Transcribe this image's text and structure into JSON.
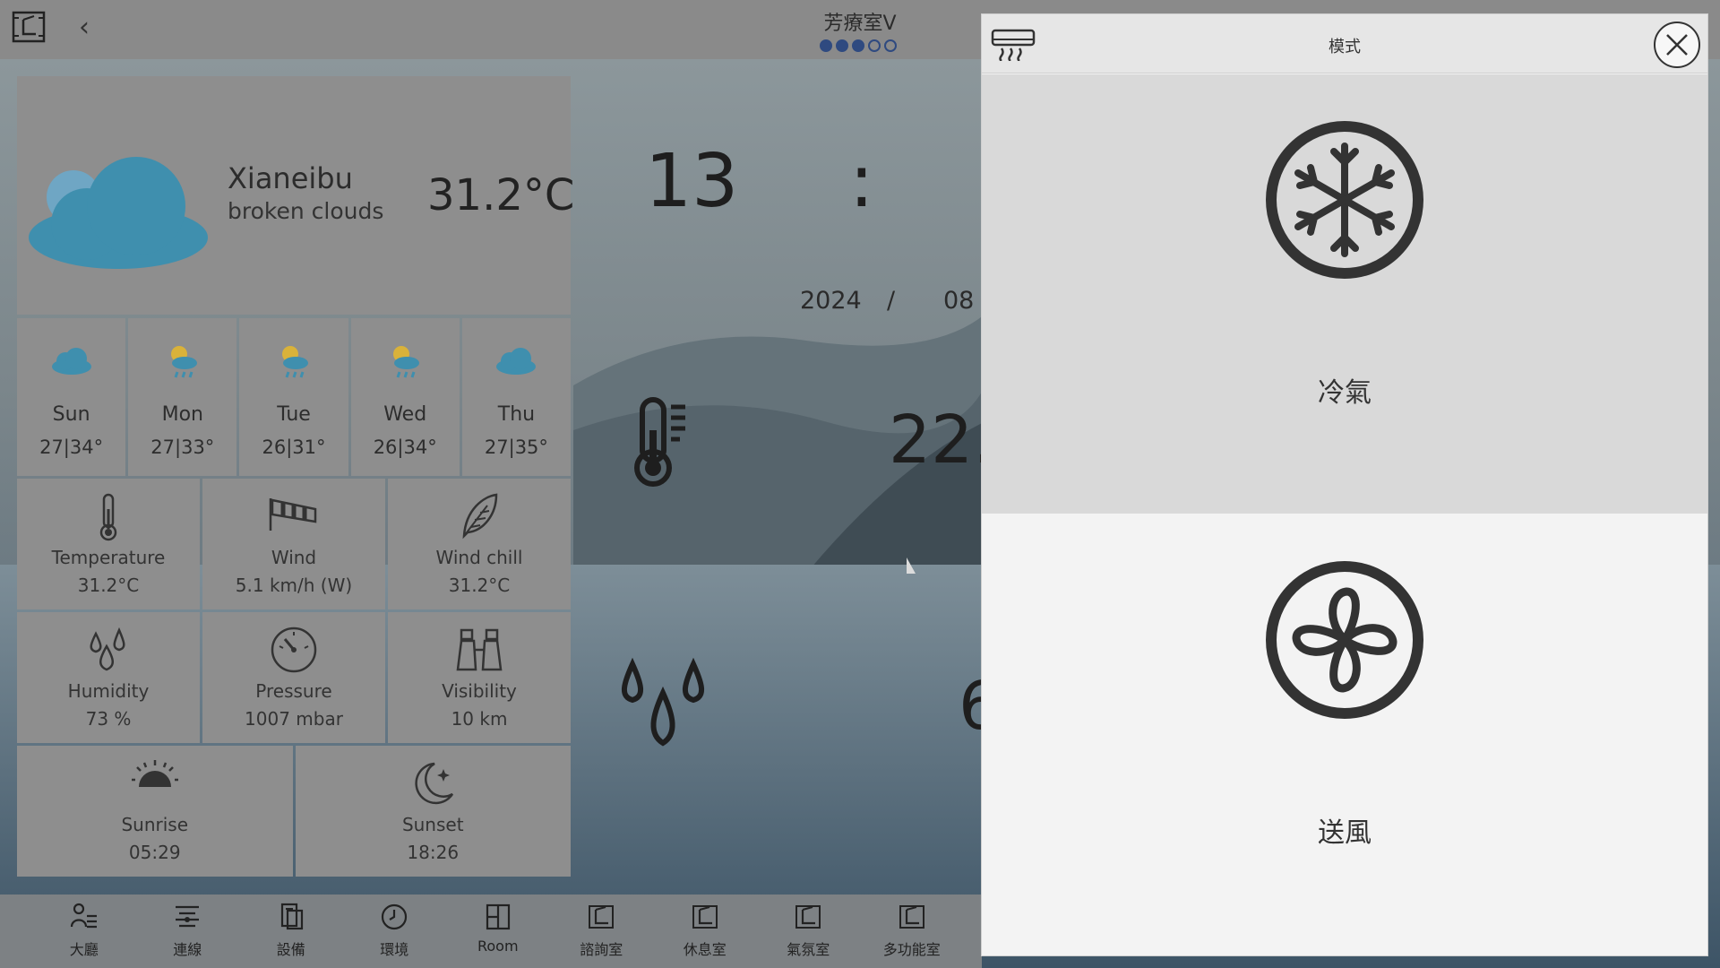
{
  "topbar": {
    "title": "芳療室V",
    "page_dots": {
      "total": 5,
      "active": 3
    },
    "back_glyph": "‹"
  },
  "weather": {
    "city": "Xianeibu",
    "description": "broken clouds",
    "temperature": "31.2°C",
    "forecast": [
      {
        "day": "Sun",
        "range": "27|34°",
        "icon": "cloud-icon"
      },
      {
        "day": "Mon",
        "range": "27|33°",
        "icon": "sun-rain-icon"
      },
      {
        "day": "Tue",
        "range": "26|31°",
        "icon": "sun-rain-icon"
      },
      {
        "day": "Wed",
        "range": "26|34°",
        "icon": "sun-rain-icon"
      },
      {
        "day": "Thu",
        "range": "27|35°",
        "icon": "cloud-icon"
      }
    ],
    "details": [
      {
        "label": "Temperature",
        "value": "31.2°C",
        "icon": "thermometer-icon"
      },
      {
        "label": "Wind",
        "value": "5.1 km/h (W)",
        "icon": "windsock-icon"
      },
      {
        "label": "Wind chill",
        "value": "31.2°C",
        "icon": "leaf-icon"
      },
      {
        "label": "Humidity",
        "value": "73 %",
        "icon": "droplets-icon"
      },
      {
        "label": "Pressure",
        "value": "1007 mbar",
        "icon": "gauge-icon"
      },
      {
        "label": "Visibility",
        "value": "10 km",
        "icon": "binoculars-icon"
      }
    ],
    "sun": [
      {
        "label": "Sunrise",
        "value": "05:29",
        "icon": "sunrise-icon"
      },
      {
        "label": "Sunset",
        "value": "18:26",
        "icon": "moon-icon"
      }
    ]
  },
  "clock": {
    "hour": "13",
    "colon": ":",
    "year": "2024",
    "sep": "/",
    "month": "08"
  },
  "sensors": {
    "temperature": "22.",
    "humidity": "6"
  },
  "nav": [
    {
      "label": "大廳",
      "icon": "people-icon"
    },
    {
      "label": "連線",
      "icon": "connection-icon"
    },
    {
      "label": "設備",
      "icon": "device-icon"
    },
    {
      "label": "環境",
      "icon": "clock-icon"
    },
    {
      "label": "Room",
      "icon": "room-icon"
    },
    {
      "label": "諮詢室",
      "icon": "room-icon"
    },
    {
      "label": "休息室",
      "icon": "room-icon"
    },
    {
      "label": "氣氛室",
      "icon": "room-icon"
    },
    {
      "label": "多功能室",
      "icon": "room-icon"
    }
  ],
  "dialog": {
    "title": "模式",
    "options": [
      {
        "label": "冷氣",
        "icon": "snowflake-icon",
        "selected": true
      },
      {
        "label": "送風",
        "icon": "fan-icon",
        "selected": false
      }
    ]
  },
  "colors": {
    "accent_dot": "#2f4a80",
    "selected_bg": "#d9d9d9"
  }
}
